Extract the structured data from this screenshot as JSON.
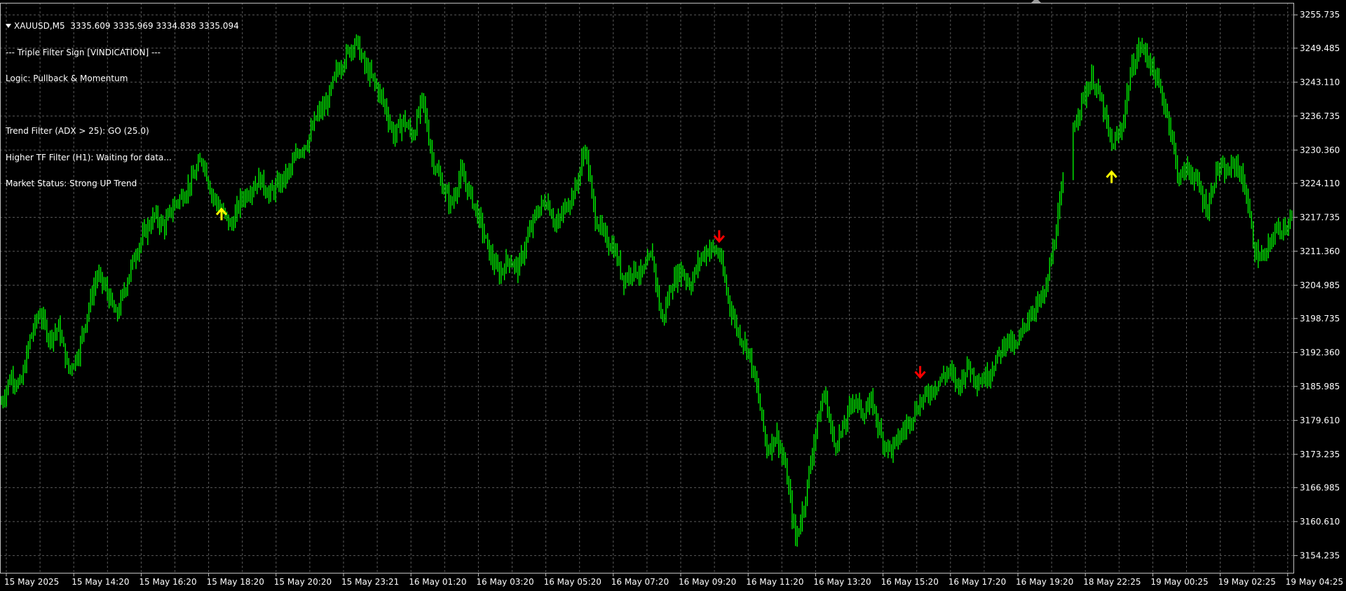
{
  "header": {
    "symbol_line": "XAUUSD,M5  3335.609 3335.969 3334.838 3335.094",
    "indicator_name": "--- Triple Filter Sign [VINDICATION] ---",
    "logic": "Logic: Pullback & Momentum",
    "trend_filter": "Trend Filter (ADX > 25): GO (25.0)",
    "higher_tf_filter": "Higher TF Filter (H1): Waiting for data...",
    "market_status": "Market Status: Strong UP Trend"
  },
  "colors": {
    "background": "#000000",
    "grid": "#5a5a5a",
    "axis": "#c0c0c0",
    "candles": "#00ff00",
    "buy_arrow": "#ffff00",
    "sell_arrow": "#ff0000"
  },
  "chart_data": {
    "type": "line",
    "title": "XAUUSD,M5",
    "xlabel": "",
    "ylabel": "",
    "ylim": [
      3151.0,
      3258.0
    ],
    "grid": true,
    "y_ticks": [
      "3255.735",
      "3249.485",
      "3243.110",
      "3236.735",
      "3230.360",
      "3224.110",
      "3217.735",
      "3211.360",
      "3204.985",
      "3198.735",
      "3192.360",
      "3185.985",
      "3179.610",
      "3173.235",
      "3166.985",
      "3160.610",
      "3154.235"
    ],
    "x_ticks": [
      "15 May 2025",
      "15 May 14:20",
      "15 May 16:20",
      "15 May 18:20",
      "15 May 20:20",
      "15 May 23:21",
      "16 May 01:20",
      "16 May 03:20",
      "16 May 05:20",
      "16 May 07:20",
      "16 May 09:20",
      "16 May 11:20",
      "16 May 13:20",
      "16 May 15:20",
      "16 May 17:20",
      "16 May 19:20",
      "18 May 22:25",
      "19 May 00:25",
      "19 May 02:25",
      "19 May 04:25"
    ],
    "series": [
      {
        "values": [
          3183,
          3188,
          3186,
          3195,
          3200,
          3195,
          3197,
          3189,
          3192,
          3200,
          3207,
          3204,
          3199,
          3205,
          3211,
          3215,
          3218,
          3216,
          3220,
          3222,
          3225,
          3229,
          3222,
          3219,
          3216,
          3221,
          3223,
          3225,
          3222,
          3224,
          3226,
          3230,
          3232,
          3237,
          3239,
          3245,
          3248,
          3251,
          3246,
          3243,
          3239,
          3233,
          3236,
          3233,
          3240,
          3229,
          3224,
          3220,
          3226,
          3222,
          3217,
          3211,
          3207,
          3210,
          3208,
          3214,
          3219,
          3221,
          3216,
          3220,
          3223,
          3231,
          3218,
          3214,
          3212,
          3206,
          3208,
          3207,
          3211,
          3198,
          3205,
          3208,
          3205,
          3210,
          3212,
          3211,
          3202,
          3196,
          3193,
          3185,
          3174,
          3177,
          3170,
          3157,
          3165,
          3177,
          3185,
          3175,
          3178,
          3184,
          3181,
          3183,
          3176,
          3174,
          3177,
          3180,
          3183,
          3185,
          3187,
          3189,
          3186,
          3190,
          3187,
          3188,
          3191,
          3195,
          3193,
          3198,
          3201,
          3203,
          3213,
          3225,
          3235,
          3240,
          3244,
          3239,
          3231,
          3234,
          3245,
          3250,
          3247,
          3242,
          3236,
          3225,
          3227,
          3224,
          3219,
          3227,
          3226,
          3228,
          3223,
          3211,
          3210,
          3215,
          3216,
          3218
        ]
      }
    ],
    "signals": [
      {
        "type": "buy",
        "index": 23,
        "value": 3218.5
      },
      {
        "type": "sell",
        "index": 75,
        "value": 3214.0
      },
      {
        "type": "sell",
        "index": 96,
        "value": 3188.5
      },
      {
        "type": "buy",
        "index": 116,
        "value": 3225.5
      }
    ]
  }
}
